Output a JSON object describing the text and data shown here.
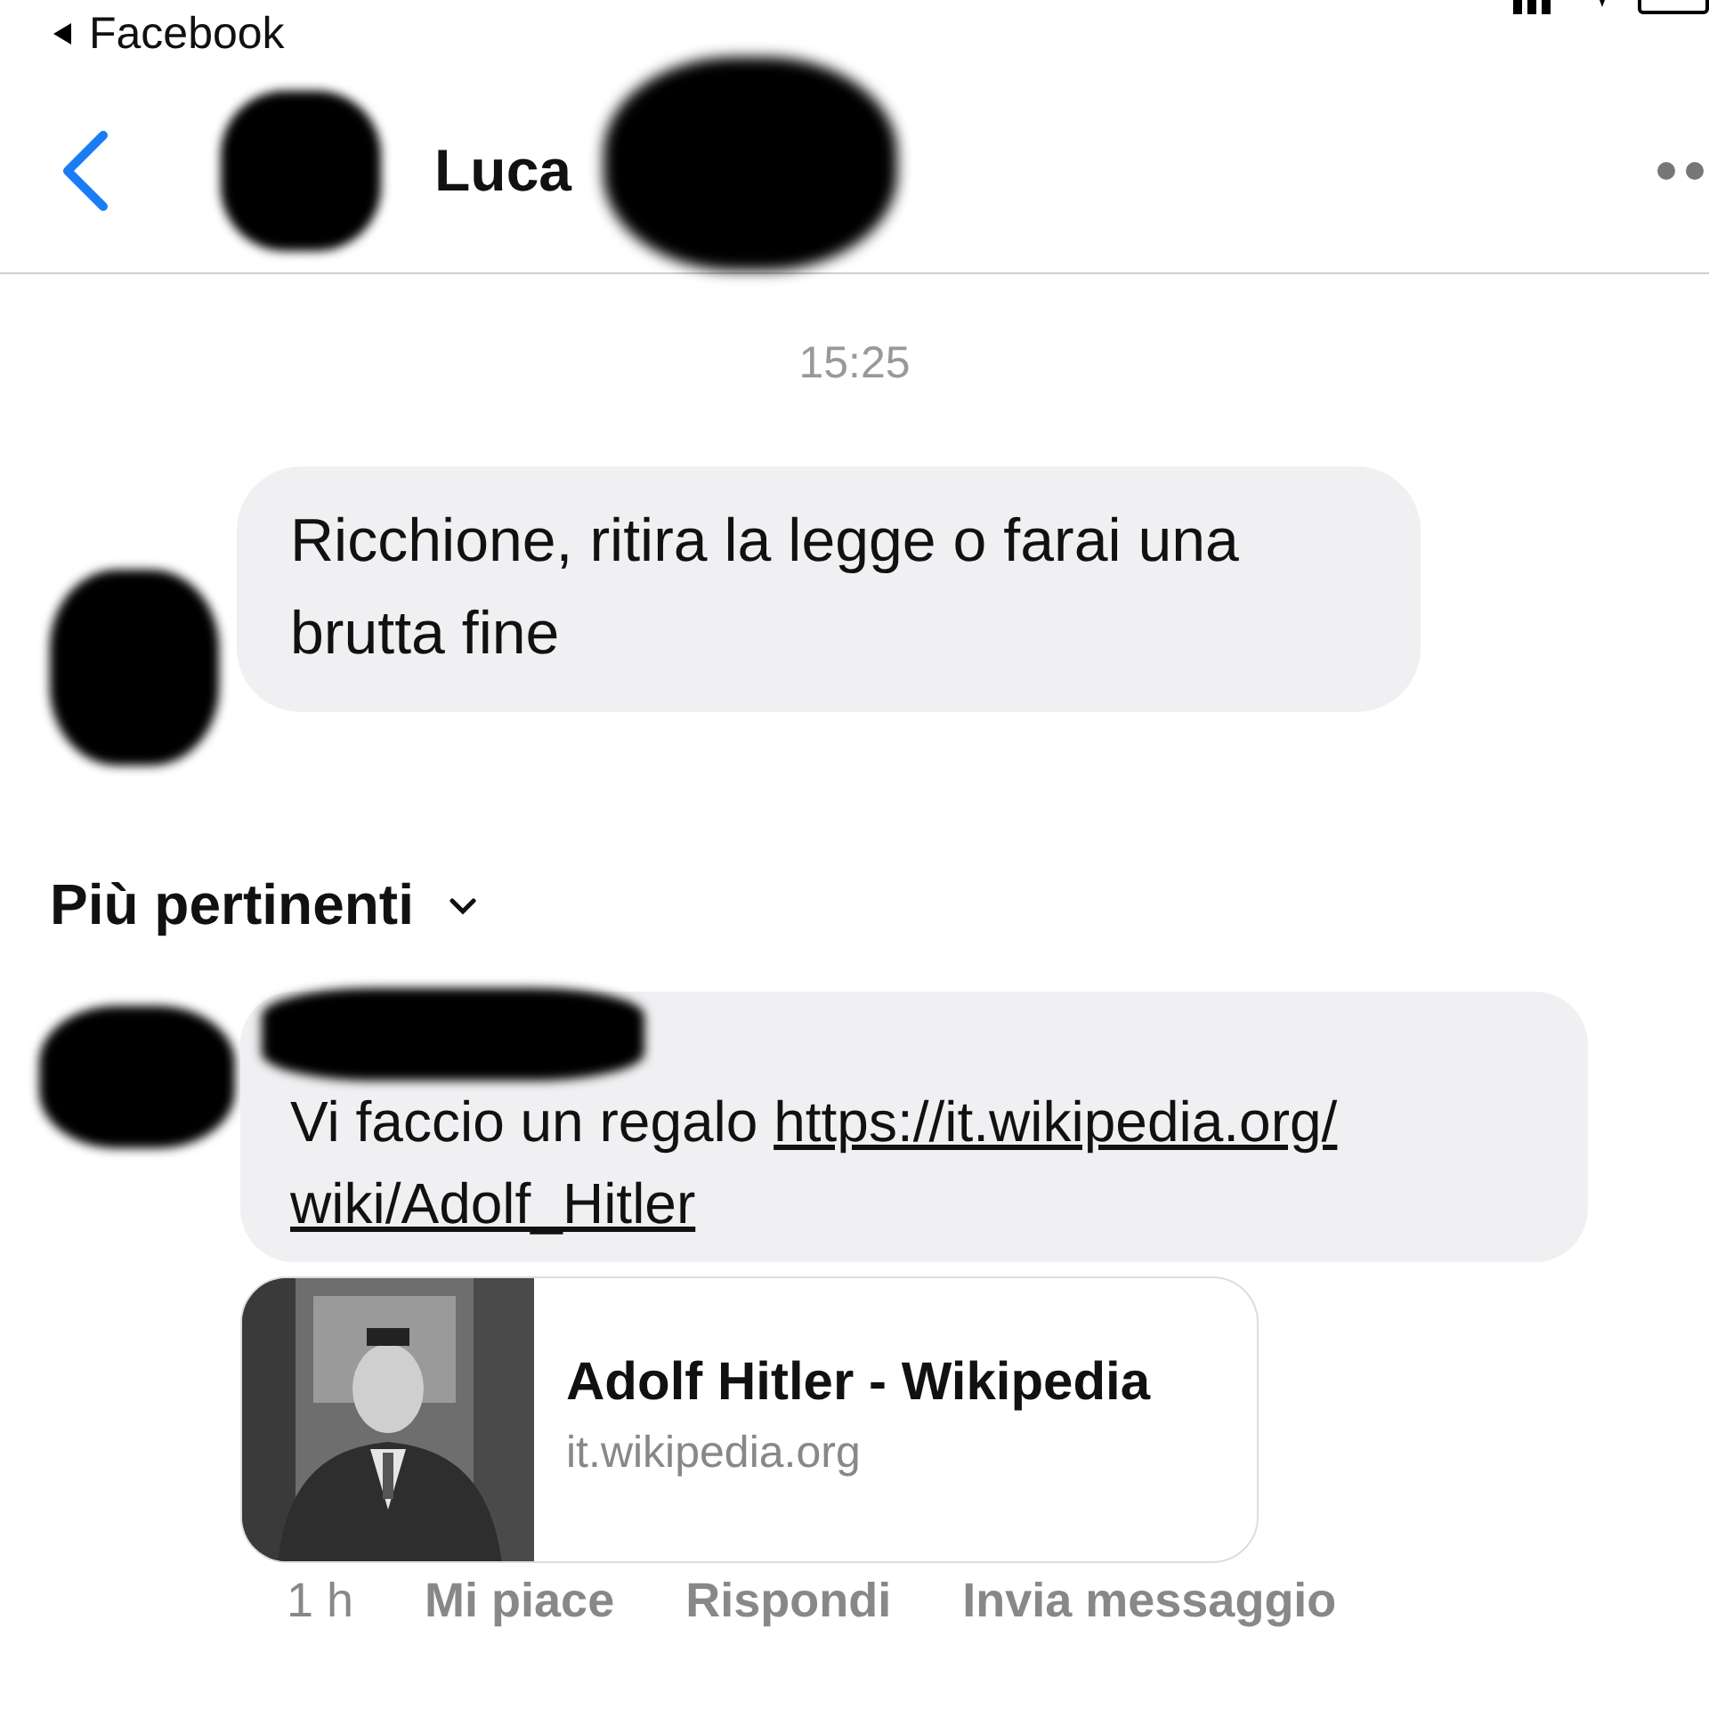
{
  "status_bar": {
    "back_app": "Facebook"
  },
  "header": {
    "title": "Luca",
    "avatar": {
      "redacted": true
    },
    "title_redacted": true
  },
  "conversation": {
    "time": "15:25",
    "messages": [
      {
        "text": "Ricchione, ritira la legge o farai una brutta fine",
        "avatar": {
          "redacted": true
        }
      }
    ]
  },
  "comments": {
    "sort_label": "Più pertinenti",
    "items": [
      {
        "avatar": {
          "redacted": true
        },
        "author_redacted": true,
        "text": "Vi faccio un regalo",
        "link_lines": [
          "https://it.wikipedia.org/",
          "wiki/Adolf_Hitler"
        ],
        "preview": {
          "kind": "picture",
          "title": "Adolf Hitler - Wikipedia",
          "domain": "it.wikipedia.org"
        },
        "time": "1 h",
        "actions": [
          "Mi piace",
          "Rispondi",
          "Invia messaggio"
        ]
      }
    ]
  }
}
